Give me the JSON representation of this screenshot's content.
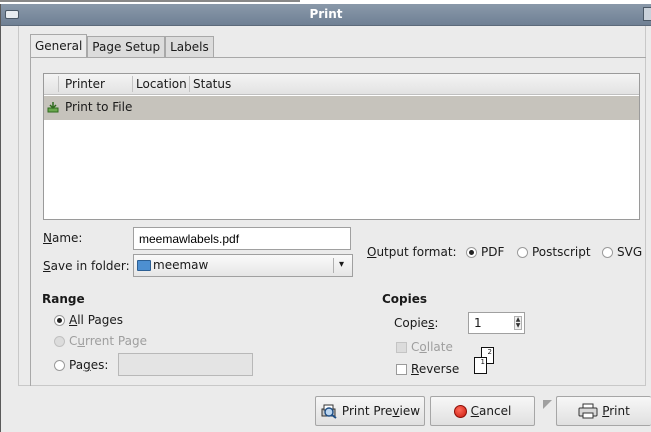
{
  "window": {
    "title": "Print"
  },
  "tabs": [
    {
      "label": "General",
      "active": true
    },
    {
      "label": "Page Setup",
      "active": false
    },
    {
      "label": "Labels",
      "active": false
    }
  ],
  "printer_list": {
    "columns": [
      "Printer",
      "Location",
      "Status"
    ],
    "rows": [
      {
        "printer": "Print to File",
        "location": "",
        "status": "",
        "selected": true,
        "icon": "print-to-file-icon"
      }
    ]
  },
  "name_field": {
    "label_pre": "",
    "label_mnemonic": "N",
    "label_post": "ame:",
    "value": "meemawlabels.pdf"
  },
  "save_folder": {
    "label_pre": "",
    "label_mnemonic": "S",
    "label_post": "ave in folder:",
    "value": "meemaw",
    "icon": "folder-icon"
  },
  "output_format": {
    "label_pre": "",
    "label_mnemonic": "O",
    "label_post": "utput format:",
    "options": [
      "PDF",
      "Postscript",
      "SVG"
    ],
    "selected": "PDF"
  },
  "range": {
    "title": "Range",
    "all_pages": {
      "pre": "",
      "mnemonic": "A",
      "post": "ll Pages",
      "selected": true
    },
    "current_page": {
      "pre": "C",
      "mnemonic": "u",
      "post": "rrent Page",
      "disabled": true
    },
    "pages": {
      "pre": "Pa",
      "mnemonic": "g",
      "post": "es:",
      "value": ""
    }
  },
  "copies": {
    "title": "Copies",
    "label_pre": "Copie",
    "label_mnemonic": "s",
    "label_post": ":",
    "value": "1",
    "collate": {
      "pre": "C",
      "mnemonic": "o",
      "post": "llate",
      "checked": false,
      "disabled": true
    },
    "reverse": {
      "pre": "",
      "mnemonic": "R",
      "post": "everse",
      "checked": false
    },
    "collate_preview": [
      "1",
      "2"
    ]
  },
  "buttons": {
    "preview": {
      "pre": "Print Pre",
      "mnemonic": "v",
      "post": "iew",
      "icon": "print-preview-icon"
    },
    "cancel": {
      "pre": "",
      "mnemonic": "C",
      "post": "ancel",
      "icon": "stop-icon"
    },
    "print": {
      "pre": "",
      "mnemonic": "P",
      "post": "rint",
      "icon": "printer-icon"
    }
  },
  "colors": {
    "titlebar": "#7b8a9c",
    "selected_row": "#c6c3bc",
    "dialog_bg": "#ebebeb",
    "cancel_icon": "#d21a0e"
  }
}
